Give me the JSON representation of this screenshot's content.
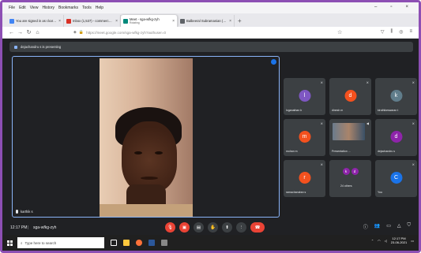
{
  "menubar": {
    "items": [
      "File",
      "Edit",
      "View",
      "History",
      "Bookmarks",
      "Tools",
      "Help"
    ]
  },
  "window_controls": [
    "–",
    "▫",
    "×"
  ],
  "tabs": [
    {
      "title": "You are signed in as r.karthik.e",
      "color": "#4285f4"
    },
    {
      "title": "Inbox (1,537) - commerce_coll",
      "color": "#d93025"
    },
    {
      "title": "Meet - sga-wfkg-zyh",
      "subtitle": "Rotating",
      "color": "#00897b",
      "active": true
    },
    {
      "title": "Balbeeral Subramanian (BVS)",
      "color": "#5f6368"
    }
  ],
  "navbar": {
    "url": "https://meet.google.com/sga-wfkg-zyh?authuser=0"
  },
  "banner": {
    "text": "dejachandru s is presenting"
  },
  "main_tile": {
    "name": "karthik s"
  },
  "participants": [
    {
      "initial": "l",
      "name": "loganathan b",
      "color": "#7e57c2"
    },
    {
      "initial": "d",
      "name": "dinesh m",
      "color": "#f4511e"
    },
    {
      "initial": "k",
      "name": "kiruthikeswaran t",
      "color": "#607d8b"
    },
    {
      "initial": "m",
      "name": "mohan m",
      "color": "#f4511e"
    },
    {
      "initial": "",
      "name": "Presentation ...",
      "color": "#3c4043",
      "presentation": true
    },
    {
      "initial": "d",
      "name": "dejachandru s",
      "color": "#8e24aa"
    },
    {
      "initial": "r",
      "name": "ramachandran s",
      "color": "#f4511e"
    },
    {
      "initial": "",
      "name": "24 others",
      "color": "#3c4043",
      "others": [
        "k",
        "d"
      ]
    },
    {
      "initial": "C",
      "name": "You",
      "color": "#1a73e8"
    }
  ],
  "bottombar": {
    "time": "12:17 PM",
    "separator": "|",
    "code": "sga-wfkg-zyh"
  },
  "taskbar": {
    "search_placeholder": "Type here to search",
    "time": "12:17 PM",
    "date": "23-06-2021"
  }
}
